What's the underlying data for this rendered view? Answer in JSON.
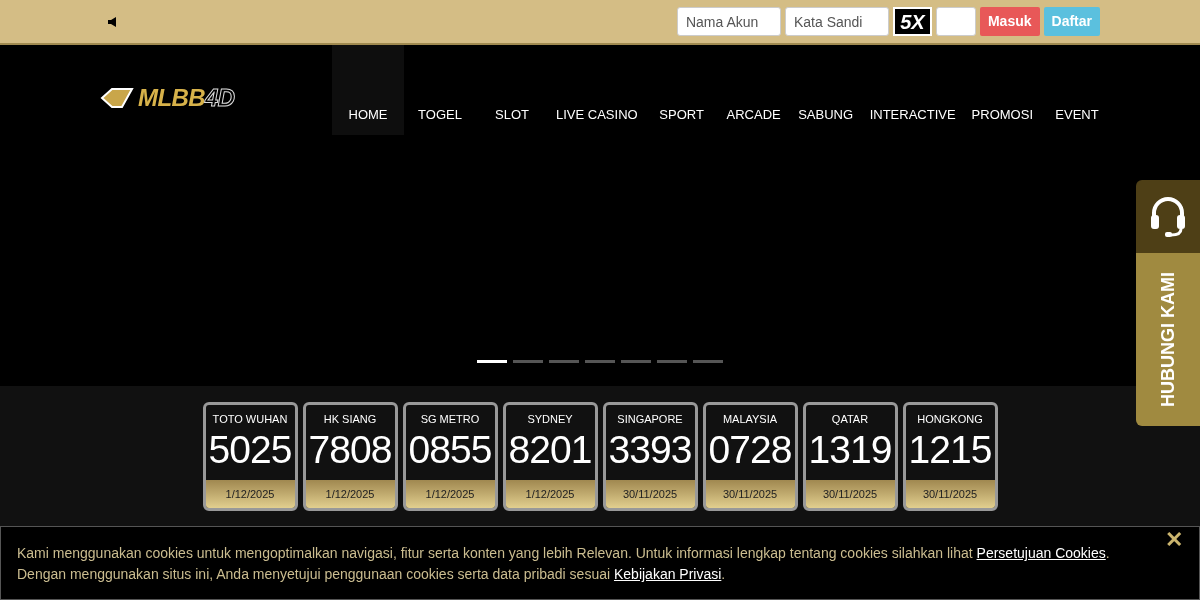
{
  "topbar": {
    "username": {
      "placeholder": "Nama Akun"
    },
    "password": {
      "placeholder": "Kata Sandi"
    },
    "captcha": "5X",
    "login_button": "Masuk",
    "register_button": "Daftar"
  },
  "logo": {
    "text": "MLBB",
    "accent": "4D"
  },
  "nav": [
    {
      "label": "HOME",
      "selected": true
    },
    {
      "label": "TOGEL",
      "selected": false
    },
    {
      "label": "SLOT",
      "selected": false
    },
    {
      "label": "LIVE CASINO",
      "selected": false
    },
    {
      "label": "SPORT",
      "selected": false
    },
    {
      "label": "ARCADE",
      "selected": false
    },
    {
      "label": "SABUNG",
      "selected": false
    },
    {
      "label": "INTERACTIVE",
      "selected": false
    },
    {
      "label": "PROMOSI",
      "selected": false
    },
    {
      "label": "EVENT",
      "selected": false
    }
  ],
  "slider_dots": [
    {
      "selected": true
    },
    {
      "selected": false
    },
    {
      "selected": false
    },
    {
      "selected": false
    },
    {
      "selected": false
    },
    {
      "selected": false
    },
    {
      "selected": false
    }
  ],
  "results": [
    {
      "market": "TOTO WUHAN",
      "number": "5025",
      "date": "1/12/2025"
    },
    {
      "market": "HK SIANG",
      "number": "7808",
      "date": "1/12/2025"
    },
    {
      "market": "SG METRO",
      "number": "0855",
      "date": "1/12/2025"
    },
    {
      "market": "SYDNEY",
      "number": "8201",
      "date": "1/12/2025"
    },
    {
      "market": "SINGAPORE",
      "number": "3393",
      "date": "30/11/2025"
    },
    {
      "market": "MALAYSIA",
      "number": "0728",
      "date": "30/11/2025"
    },
    {
      "market": "QATAR",
      "number": "1319",
      "date": "30/11/2025"
    },
    {
      "market": "HONGKONG",
      "number": "1215",
      "date": "30/11/2025"
    }
  ],
  "contact_widget": {
    "label": "HUBUNGI KAMI"
  },
  "cookie_bar": {
    "line1": "Kami menggunakan cookies untuk mengoptimalkan navigasi, fitur serta konten yang lebih Relevan. Untuk informasi lengkap tentang cookies silahkan lihat",
    "link1": "Persetujuan Cookies",
    "line1_end": ".",
    "line2": "Dengan menggunakan situs ini, Anda menyetujui penggunaan cookies serta data pribadi sesuai",
    "link2": "Kebijakan Privasi",
    "line2_end": ".",
    "close": "✕"
  }
}
